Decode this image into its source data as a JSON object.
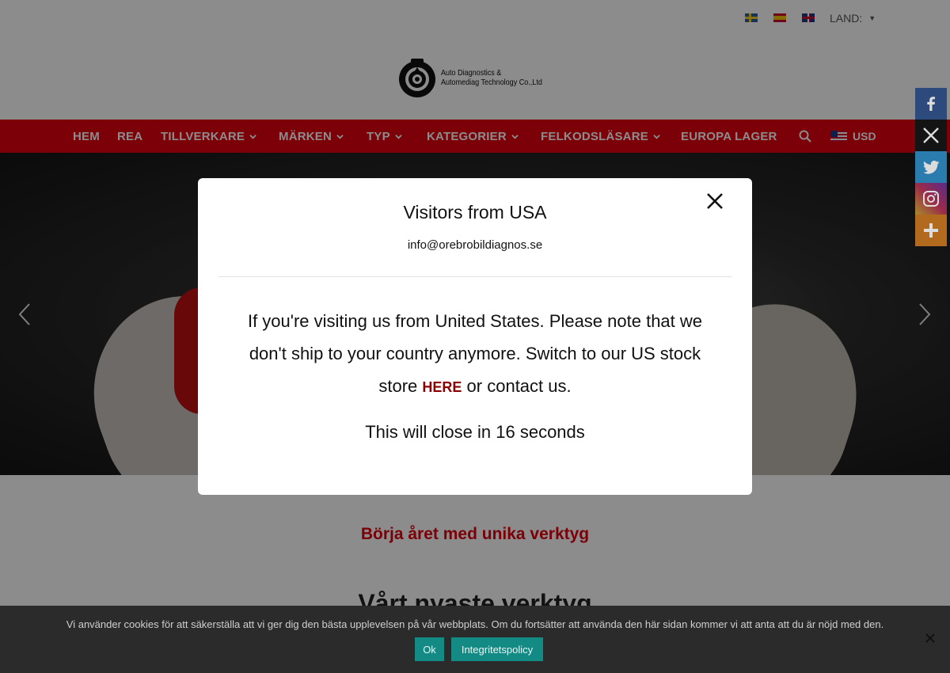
{
  "topbar": {
    "flags": [
      {
        "name": "Svenska",
        "icon": "sweden-flag-icon"
      },
      {
        "name": "Español",
        "icon": "spain-flag-icon"
      },
      {
        "name": "English",
        "icon": "uk-flag-icon"
      }
    ],
    "country_label": "LAND:"
  },
  "logo": {
    "line1": "Auto Diagnostics &",
    "line2": "Automediag Technology Co.,Ltd"
  },
  "nav": {
    "items": [
      {
        "label": "HEM",
        "has_dropdown": false
      },
      {
        "label": "REA",
        "has_dropdown": false
      },
      {
        "label": "TILLVERKARE",
        "has_dropdown": true
      },
      {
        "label": "MÄRKEN",
        "has_dropdown": true
      },
      {
        "label": "TYP",
        "has_dropdown": true
      },
      {
        "label": "KATEGORIER",
        "has_dropdown": true
      },
      {
        "label": "FELKODSLÄSARE",
        "has_dropdown": true
      },
      {
        "label": "EUROPA LAGER",
        "has_dropdown": false
      }
    ],
    "currency": "USD",
    "accent_color": "#e0000f"
  },
  "hero": {
    "prev_icon": "chevron-left-icon",
    "next_icon": "chevron-right-icon"
  },
  "content": {
    "tagline": "Börja året med unika verktyg",
    "section_title": "Vårt nyaste verktyg"
  },
  "social": {
    "items": [
      {
        "name": "Facebook",
        "icon": "facebook-icon"
      },
      {
        "name": "X",
        "icon": "x-icon"
      },
      {
        "name": "Twitter",
        "icon": "twitter-icon"
      },
      {
        "name": "Instagram",
        "icon": "instagram-icon"
      },
      {
        "name": "More",
        "icon": "plus-icon"
      }
    ]
  },
  "modal": {
    "title": "Visitors from USA",
    "email": "info@orebrobildiagnos.se",
    "body_before": "If you're visiting us from United States. Please note that we don't ship to your country anymore. Switch to our US stock store",
    "link_label": "HERE",
    "body_after": "or contact us.",
    "countdown": "This will close in 16 seconds"
  },
  "cookie": {
    "text": "Vi använder cookies för att säkerställa att vi ger dig den bästa upplevelsen på vår webbplats. Om du fortsätter att använda den här sidan kommer vi att anta att du är nöjd med den.",
    "ok_label": "Ok",
    "policy_label": "Integritetspolicy"
  }
}
